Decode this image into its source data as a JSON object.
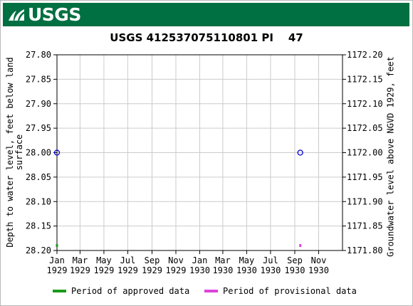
{
  "header": {
    "logo_text": "USGS"
  },
  "chart_data": {
    "type": "scatter",
    "title": "USGS 412537075110801 PI    47",
    "ylabel_left": "Depth to water level, feet below land\nsurface",
    "ylabel_right": "Groundwater level above NGVD 1929, feet",
    "y_left_ticks": [
      "27.80",
      "27.85",
      "27.90",
      "27.95",
      "28.00",
      "28.05",
      "28.10",
      "28.15",
      "28.20"
    ],
    "y_right_ticks": [
      "1172.20",
      "1172.15",
      "1172.10",
      "1172.05",
      "1172.00",
      "1171.95",
      "1171.90",
      "1171.85",
      "1171.80"
    ],
    "ylim_left": [
      27.8,
      28.2
    ],
    "y_left_inverted": true,
    "ylim_right": [
      1171.8,
      1172.2
    ],
    "x_ticks": [
      {
        "month": "Jan",
        "year": "1929"
      },
      {
        "month": "Mar",
        "year": "1929"
      },
      {
        "month": "May",
        "year": "1929"
      },
      {
        "month": "Jul",
        "year": "1929"
      },
      {
        "month": "Sep",
        "year": "1929"
      },
      {
        "month": "Nov",
        "year": "1929"
      },
      {
        "month": "Jan",
        "year": "1930"
      },
      {
        "month": "Mar",
        "year": "1930"
      },
      {
        "month": "May",
        "year": "1930"
      },
      {
        "month": "Jul",
        "year": "1930"
      },
      {
        "month": "Sep",
        "year": "1930"
      },
      {
        "month": "Nov",
        "year": "1930"
      }
    ],
    "xlim": [
      "1929-01-01",
      "1931-01-01"
    ],
    "grid": true,
    "points": [
      {
        "date": "1929-01-01",
        "depth": 28.0,
        "status": "approved"
      },
      {
        "date": "1930-09-15",
        "depth": 28.0,
        "status": "provisional"
      }
    ],
    "legend": [
      {
        "label": "Period of approved data",
        "color": "#1a9a1a"
      },
      {
        "label": "Period of provisional data",
        "color": "#dd44dd"
      }
    ],
    "marker_color": "#0000cc"
  }
}
